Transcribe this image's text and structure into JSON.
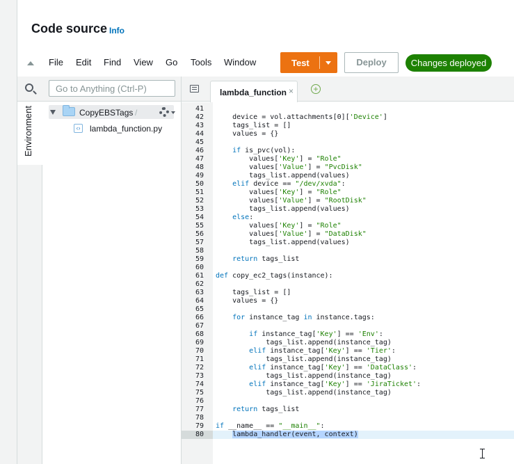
{
  "header": {
    "title": "Code source",
    "info": "Info"
  },
  "toolbar": {
    "menu": [
      "File",
      "Edit",
      "Find",
      "View",
      "Go",
      "Tools",
      "Window"
    ],
    "test_label": "Test",
    "deploy_label": "Deploy",
    "status_badge": "Changes deployed"
  },
  "sidebar": {
    "search_placeholder": "Go to Anything (Ctrl-P)",
    "environment_label": "Environment",
    "folder_name": "CopyEBSTags",
    "folder_slash": "/",
    "file_name": "lambda_function.py"
  },
  "editor": {
    "tab_label": "lambda_function",
    "tab_close": "×",
    "add_tab": "+",
    "current_line": 80,
    "lines": [
      {
        "n": "41",
        "t": ""
      },
      {
        "n": "42",
        "t": "    device = vol.attachments[0]['Device']"
      },
      {
        "n": "43",
        "t": "    tags_list = []"
      },
      {
        "n": "44",
        "t": "    values = {}"
      },
      {
        "n": "45",
        "t": ""
      },
      {
        "n": "46",
        "t": "    if is_pvc(vol):"
      },
      {
        "n": "47",
        "t": "        values['Key'] = \"Role\""
      },
      {
        "n": "48",
        "t": "        values['Value'] = \"PvcDisk\""
      },
      {
        "n": "49",
        "t": "        tags_list.append(values)"
      },
      {
        "n": "50",
        "t": "    elif device == \"/dev/xvda\":"
      },
      {
        "n": "51",
        "t": "        values['Key'] = \"Role\""
      },
      {
        "n": "52",
        "t": "        values['Value'] = \"RootDisk\""
      },
      {
        "n": "53",
        "t": "        tags_list.append(values)"
      },
      {
        "n": "54",
        "t": "    else:"
      },
      {
        "n": "55",
        "t": "        values['Key'] = \"Role\""
      },
      {
        "n": "56",
        "t": "        values['Value'] = \"DataDisk\""
      },
      {
        "n": "57",
        "t": "        tags_list.append(values)"
      },
      {
        "n": "58",
        "t": ""
      },
      {
        "n": "59",
        "t": "    return tags_list"
      },
      {
        "n": "60",
        "t": ""
      },
      {
        "n": "61",
        "t": "def copy_ec2_tags(instance):"
      },
      {
        "n": "62",
        "t": ""
      },
      {
        "n": "63",
        "t": "    tags_list = []"
      },
      {
        "n": "64",
        "t": "    values = {}"
      },
      {
        "n": "65",
        "t": ""
      },
      {
        "n": "66",
        "t": "    for instance_tag in instance.tags:"
      },
      {
        "n": "67",
        "t": ""
      },
      {
        "n": "68",
        "t": "        if instance_tag['Key'] == 'Env':"
      },
      {
        "n": "69",
        "t": "            tags_list.append(instance_tag)"
      },
      {
        "n": "70",
        "t": "        elif instance_tag['Key'] == 'Tier':"
      },
      {
        "n": "71",
        "t": "            tags_list.append(instance_tag)"
      },
      {
        "n": "72",
        "t": "        elif instance_tag['Key'] == 'DataClass':"
      },
      {
        "n": "73",
        "t": "            tags_list.append(instance_tag)"
      },
      {
        "n": "74",
        "t": "        elif instance_tag['Key'] == 'JiraTicket':"
      },
      {
        "n": "75",
        "t": "            tags_list.append(instance_tag)"
      },
      {
        "n": "76",
        "t": ""
      },
      {
        "n": "77",
        "t": "    return tags_list"
      },
      {
        "n": "78",
        "t": ""
      },
      {
        "n": "79",
        "t": "if __name__ == \"__main__\":"
      },
      {
        "n": "80",
        "t": "    lambda_handler(event, context)"
      }
    ]
  },
  "colors": {
    "test_button": "#ec7211",
    "badge_green": "#1d8102",
    "link_blue": "#0073bb"
  }
}
